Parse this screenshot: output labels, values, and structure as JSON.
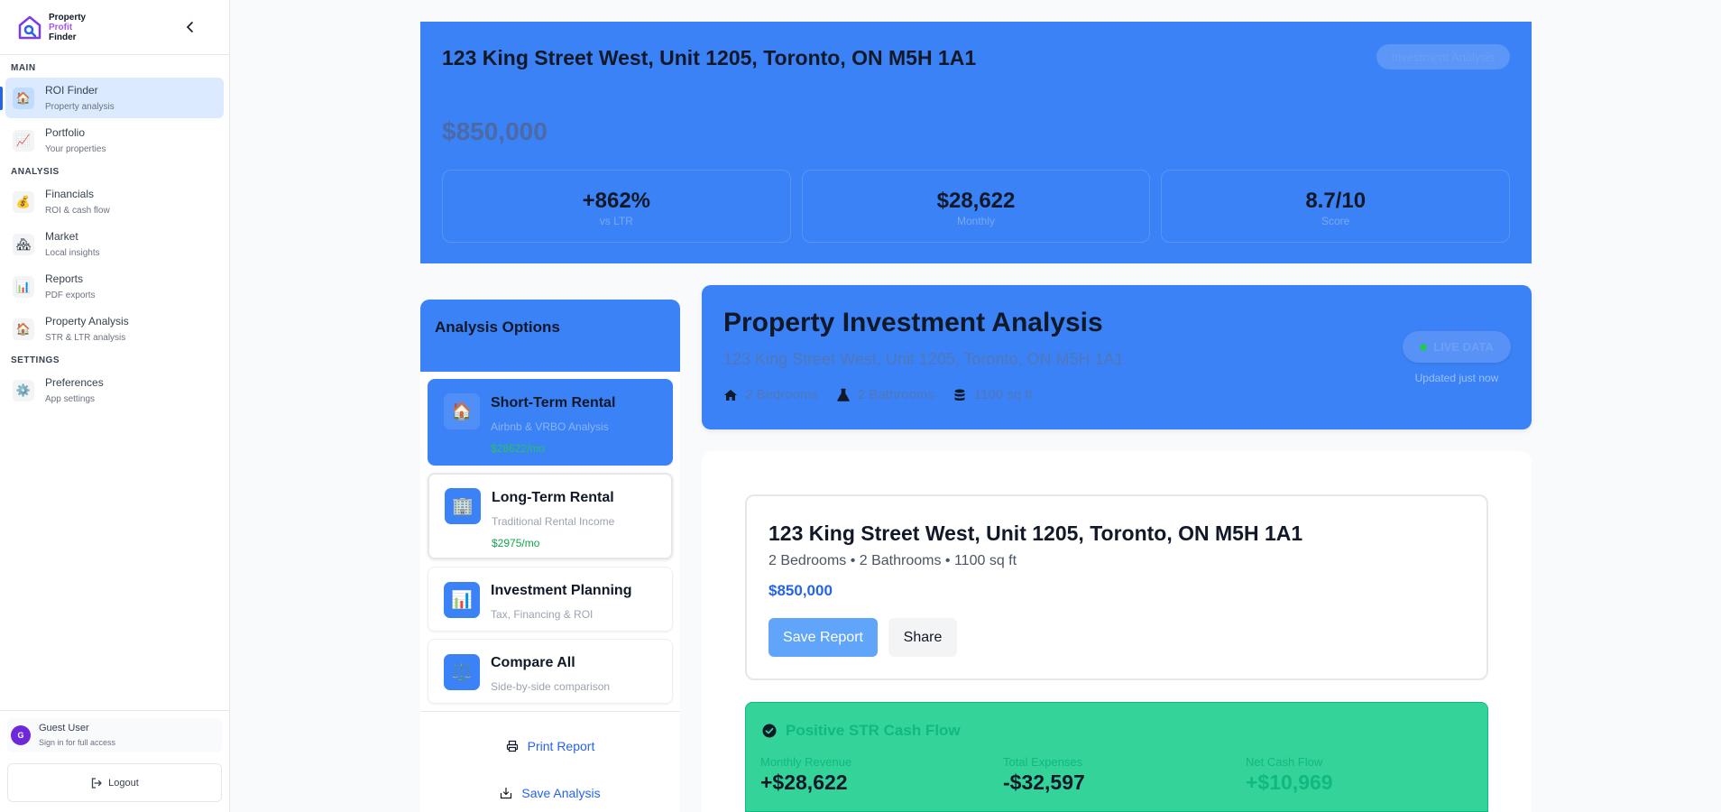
{
  "sidebar": {
    "logo": {
      "line1": "Property",
      "line2": "Profit",
      "line3": "Finder"
    },
    "sections": {
      "main": "MAIN",
      "analysis": "ANALYSIS",
      "settings": "SETTINGS"
    },
    "items": [
      {
        "title": "ROI Finder",
        "sub": "Property analysis",
        "icon": "🏠"
      },
      {
        "title": "Portfolio",
        "sub": "Your properties",
        "icon": "📈"
      },
      {
        "title": "Financials",
        "sub": "ROI & cash flow",
        "icon": "💰"
      },
      {
        "title": "Market",
        "sub": "Local insights",
        "icon": "🏘"
      },
      {
        "title": "Reports",
        "sub": "PDF exports",
        "icon": "📊"
      },
      {
        "title": "Property Analysis",
        "sub": "STR & LTR analysis",
        "icon": "🏠"
      },
      {
        "title": "Preferences",
        "sub": "App settings",
        "icon": "⚙️"
      }
    ],
    "user": {
      "initial": "G",
      "name": "Guest User",
      "sub": "Sign in for full access"
    },
    "logout": "Logout"
  },
  "hero": {
    "address": "123 King Street West, Unit 1205, Toronto, ON M5H 1A1",
    "pill": "Investment Analysis",
    "price": "$850,000",
    "stats": [
      {
        "value": "+862%",
        "label": "vs LTR"
      },
      {
        "value": "$28,622",
        "label": "Monthly"
      },
      {
        "value": "8.7/10",
        "label": "Score"
      }
    ]
  },
  "options": {
    "title": "Analysis Options",
    "cards": [
      {
        "title": "Short-Term Rental",
        "sub": "Airbnb & VRBO Analysis",
        "price": "$28622/mo",
        "icon": "🏠"
      },
      {
        "title": "Long-Term Rental",
        "sub": "Traditional Rental Income",
        "price": "$2975/mo",
        "icon": "🏢"
      },
      {
        "title": "Investment Planning",
        "sub": "Tax, Financing & ROI",
        "icon": "📊"
      },
      {
        "title": "Compare All",
        "sub": "Side-by-side comparison",
        "icon": "⚖️"
      }
    ],
    "print": "Print Report",
    "save": "Save Analysis"
  },
  "analysis": {
    "title": "Property Investment Analysis",
    "address": "123 King Street West, Unit 1205, Toronto, ON M5H 1A1",
    "bedrooms": "2 Bedrooms",
    "bathrooms": "2 Bathrooms",
    "sqft": "1100 sq ft",
    "live": "LIVE DATA",
    "updated": "Updated just now"
  },
  "property": {
    "title": "123 King Street West, Unit 1205, Toronto, ON M5H 1A1",
    "meta": "2 Bedrooms • 2 Bathrooms • 1100 sq ft",
    "price": "$850,000",
    "save": "Save Report",
    "share": "Share"
  },
  "cashflow": {
    "title": "Positive STR Cash Flow",
    "revenue_label": "Monthly Revenue",
    "revenue": "+$28,622",
    "expenses_label": "Total Expenses",
    "expenses": "-$32,597",
    "net_label": "Net Cash Flow",
    "net": "+$10,969"
  },
  "colors": {
    "accent": "#3b82f6",
    "success": "#34d399",
    "brand_purple": "#a855f7"
  }
}
